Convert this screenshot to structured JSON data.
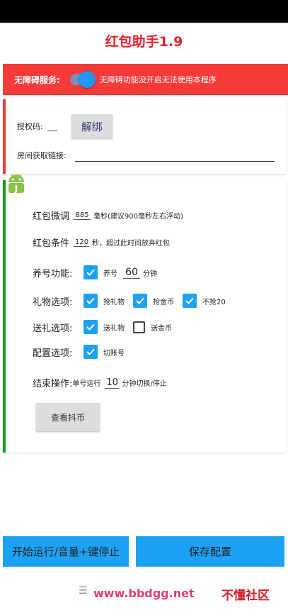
{
  "app": {
    "title": "红包助手1.9"
  },
  "accessibility": {
    "label": "无障碍服务:",
    "message": "无障碍功能没开启无法使用本程序",
    "enabled": true
  },
  "license": {
    "label": "授权码:",
    "unbind_button": "解绑",
    "room_label": "房间获取链接:"
  },
  "settings": {
    "fine_tune": {
      "label": "红包微调",
      "value": "885",
      "suffix": "毫秒(建议900毫秒左右浮动)"
    },
    "condition": {
      "label": "红包条件",
      "value": "120",
      "suffix": "秒，超过此时间放弃红包"
    },
    "nurture": {
      "label": "养号功能:",
      "checkbox_label": "养号",
      "checked": true,
      "value": "60",
      "unit": "分钟"
    },
    "gift": {
      "label": "礼物选项:",
      "options": [
        {
          "label": "抢礼物",
          "checked": true
        },
        {
          "label": "抢金币",
          "checked": true
        },
        {
          "label": "不抢20",
          "checked": true
        }
      ]
    },
    "send_gift": {
      "label": "送礼选项:",
      "options": [
        {
          "label": "送礼物",
          "checked": true
        },
        {
          "label": "送金币",
          "checked": false
        }
      ]
    },
    "config": {
      "label": "配置选项:",
      "options": [
        {
          "label": "切账号",
          "checked": true
        }
      ]
    },
    "end_action": {
      "label": "结束操作:",
      "prefix": "单号运行",
      "value": "10",
      "suffix": "分钟切换/停止"
    },
    "check_coins_button": "查看抖币"
  },
  "actions": {
    "start_label": "开始运行/音量+键停止",
    "save_label": "保存配置"
  },
  "navbar": {
    "menu_icon": "hamburger-icon",
    "watermark_url": "www.bbdgg.net",
    "watermark_text": "不懂社区"
  },
  "colors": {
    "title": "#e8202a",
    "accessibility_bar": "#f53a3a",
    "accent": "#1da1f2",
    "card1_border": "#f03a3a",
    "card2_border": "#1a9a2a"
  }
}
